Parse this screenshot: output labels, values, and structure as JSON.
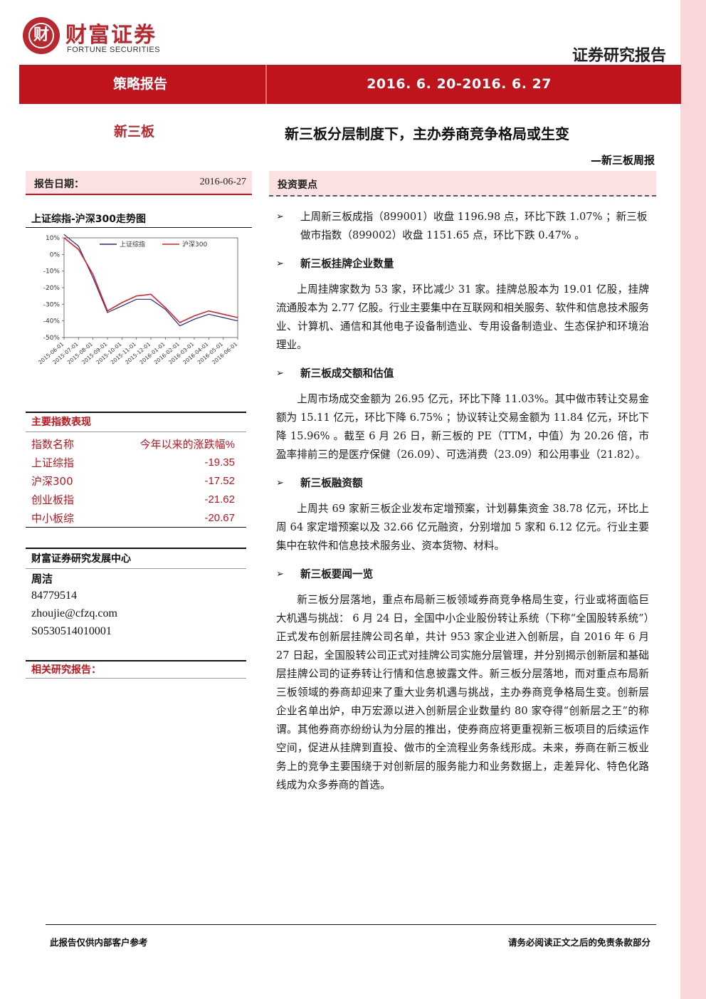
{
  "header": {
    "logo_glyph": "财",
    "logo_cn": "财富证券",
    "logo_en": "FORTUNE SECURITIES",
    "report_type": "证券研究报告",
    "banner_left": "策略报告",
    "banner_right": "2016. 6. 20-2016. 6. 27"
  },
  "section_tag": "新三板",
  "title": "新三板分层制度下，主办券商竞争格局或生变",
  "subtitle": "—新三板周报",
  "report_date": {
    "label": "报告日期：",
    "value": "2016-06-27"
  },
  "investment_points_label": "投资要点",
  "chart_title": "上证综指-沪深300走势图",
  "chart_data": {
    "type": "line",
    "x": [
      "2015-06-01",
      "2015-07-01",
      "2015-08-01",
      "2015-09-01",
      "2015-10-01",
      "2015-11-01",
      "2015-12-01",
      "2016-01-01",
      "2016-02-01",
      "2016-03-01",
      "2016-04-01",
      "2016-05-01",
      "2016-06-01"
    ],
    "series": [
      {
        "name": "上证综指",
        "color": "#1f2a8a",
        "values": [
          12,
          5,
          -14,
          -35,
          -31,
          -27,
          -27,
          -33,
          -43,
          -39,
          -36,
          -38,
          -40
        ]
      },
      {
        "name": "沪深300",
        "color": "#e0202a",
        "values": [
          10,
          3,
          -12,
          -34,
          -29,
          -25,
          -24,
          -32,
          -41,
          -37,
          -34,
          -36,
          -38
        ]
      }
    ],
    "ylim": [
      -50,
      10
    ],
    "yticks": [
      "10%",
      "0%",
      "-10%",
      "-20%",
      "-30%",
      "-40%",
      "-50%"
    ],
    "legend": "top",
    "grid": false
  },
  "indices": {
    "title": "主要指数表现",
    "headers": [
      "指数名称",
      "今年以来的涨跌幅%"
    ],
    "rows": [
      {
        "name": "上证综指",
        "value": "-19.35"
      },
      {
        "name": "沪深300",
        "value": "-17.52"
      },
      {
        "name": "创业板指",
        "value": "-21.62"
      },
      {
        "name": "中小板综",
        "value": "-20.67"
      }
    ]
  },
  "research_center": {
    "title": "财富证券研究发展中心",
    "analyst": "周洁",
    "phone": "84779514",
    "email": "zhoujie@cfzq.com",
    "cert": "S0530514010001"
  },
  "related_reports": "相关研究报告：",
  "body": {
    "arrow": "➢",
    "summary": "上周新三板成指（899001）收盘 1196.98 点，环比下跌 1.07% ；新三板做市指数（899002）收盘 1151.65 点，环比下跌 0.47% 。",
    "sec1_title": "新三板挂牌企业数量",
    "sec1_text": "上周挂牌家数为 53 家，环比减少 31 家。挂牌总股本为 19.01 亿股，挂牌流通股本为 2.77 亿股。行业主要集中在互联网和相关服务、软件和信息技术服务业、计算机、通信和其他电子设备制造业、专用设备制造业、生态保护和环境治理业。",
    "sec2_title": "新三板成交额和估值",
    "sec2_text": "上周市场成交金额为 26.95 亿元，环比下降 11.03%。其中做市转让交易金额为 15.11 亿元，环比下降 6.75% ；协议转让交易金额为 11.84 亿元，环比下降 15.96% 。截至 6 月 26 日，新三板的 PE（TTM，中值）为 20.26 倍，市盈率排前三的是医疗保健（26.09）、可选消费（23.09）和公用事业（21.82）。",
    "sec3_title": "新三板融资额",
    "sec3_text": "上周共 69 家新三板企业发布定增预案，计划募集资金 38.78 亿元，环比上周 64 家定增预案以及 32.66 亿元融资，分别增加 5 家和 6.12 亿元。行业主要集中在软件和信息技术服务业、资本货物、材料。",
    "sec4_title": "新三板要闻一览",
    "sec4_text": "新三板分层落地，重点布局新三板领域券商竞争格局生变，行业或将面临巨大机遇与挑战： 6 月 24 日，全国中小企业股份转让系统（下称“全国股转系统”）正式发布创新层挂牌公司名单，共计 953 家企业进入创新层，自 2016 年 6 月 27 日起，全国股转公司正式对挂牌公司实施分层管理，并分别揭示创新层和基础层挂牌公司的证券转让行情和信息披露文件。新三板分层落地，而对重点布局新三板领域的券商却迎来了重大业务机遇与挑战，主办券商竞争格局生变。创新层企业名单出炉，申万宏源以进入创新层企业数量约 80 家夺得“创新层之王”的称谓。其他券商亦纷纷认为分层的推出，使券商应将更重视新三板项目的后续运作空间，促进从挂牌到直投、做市的全流程业务条线形成。未来，券商在新三板业务上的竞争主要围绕于对创新层的服务能力和业务数据上，走差异化、特色化路线成为众多券商的首选。"
  },
  "footer": {
    "left": "此报告仅供内部客户参考",
    "right": "请务必阅读正文之后的免责条款部分"
  }
}
